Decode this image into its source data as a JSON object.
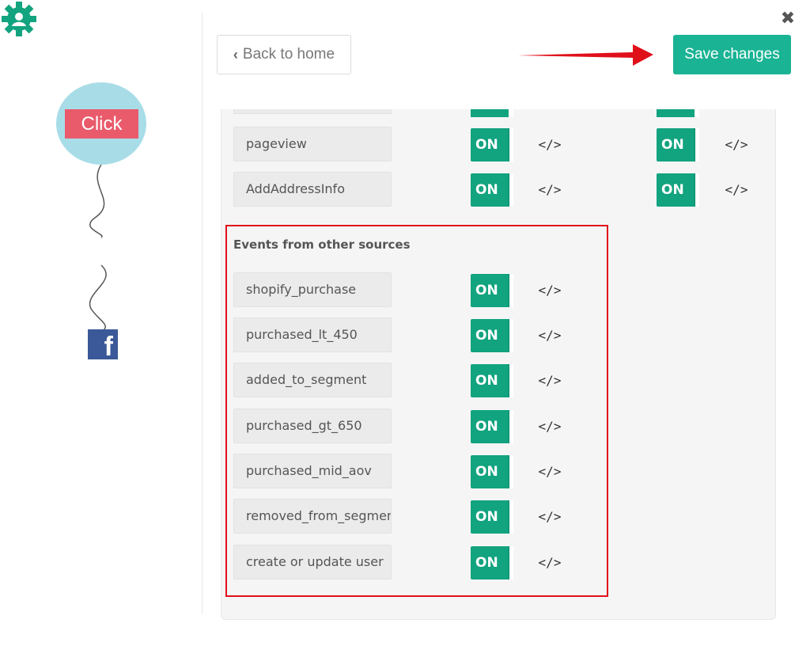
{
  "toolbar": {
    "back_label": "Back to home",
    "save_label": "Save changes",
    "close_glyph": "✖"
  },
  "flow": {
    "node_label": "Click",
    "gear_icon": "gear-icon",
    "fb_glyph": "f"
  },
  "events": {
    "primary_rows": [
      {
        "name": "pageview",
        "toggle1": "ON",
        "code1": "</>",
        "toggle2": "ON",
        "code2": "</>"
      },
      {
        "name": "AddAddressInfo",
        "toggle1": "ON",
        "code1": "</>",
        "toggle2": "ON",
        "code2": "</>"
      }
    ],
    "other_sources_title": "Events from other sources",
    "other_rows": [
      {
        "name": "shopify_purchase",
        "toggle": "ON",
        "code": "</>"
      },
      {
        "name": "purchased_lt_450",
        "toggle": "ON",
        "code": "</>"
      },
      {
        "name": "added_to_segment",
        "toggle": "ON",
        "code": "</>"
      },
      {
        "name": "purchased_gt_650",
        "toggle": "ON",
        "code": "</>"
      },
      {
        "name": "purchased_mid_aov",
        "toggle": "ON",
        "code": "</>"
      },
      {
        "name": "removed_from_segment",
        "toggle": "ON",
        "code": "</>"
      },
      {
        "name": "create or update user",
        "toggle": "ON",
        "code": "</>"
      }
    ]
  },
  "colors": {
    "accent": "#1ab394",
    "toggle_on": "#12a37f",
    "highlight": "#e0101a",
    "arrow": "#e0101a",
    "click_bg": "#e95b6b",
    "node_bg": "#a8dde8",
    "facebook": "#3b5998"
  }
}
